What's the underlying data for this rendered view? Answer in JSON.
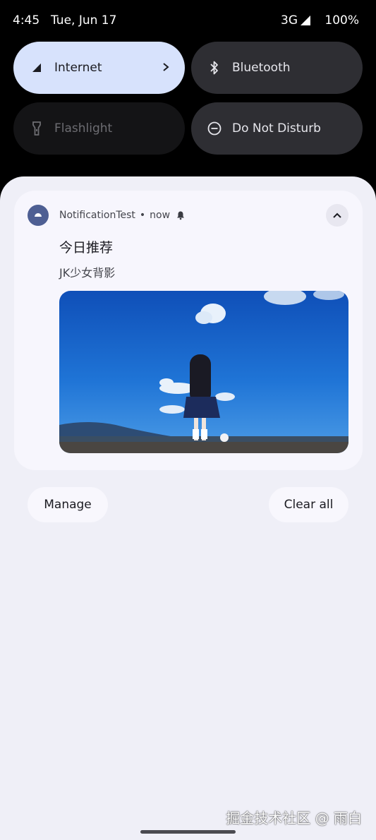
{
  "status_bar": {
    "time": "4:45",
    "date": "Tue, Jun 17",
    "network": "3G",
    "battery": "100%"
  },
  "quick_settings": {
    "internet": "Internet",
    "bluetooth": "Bluetooth",
    "flashlight": "Flashlight",
    "do_not_disturb": "Do Not Disturb"
  },
  "notification": {
    "app_name": "NotificationTest",
    "separator": "•",
    "time": "now",
    "title": "今日推荐",
    "text": "JK少女背影",
    "image_icon": "photo-girl-blue-sky"
  },
  "actions": {
    "manage": "Manage",
    "clear_all": "Clear all"
  },
  "watermark": "掘金技术社区 @ 雨白",
  "colors": {
    "internet_tile": "#d7e2fc",
    "dark_tile": "#2e2e33",
    "shade": "#efeff7",
    "card": "#f7f6fd",
    "app_icon": "#4e5f93"
  }
}
